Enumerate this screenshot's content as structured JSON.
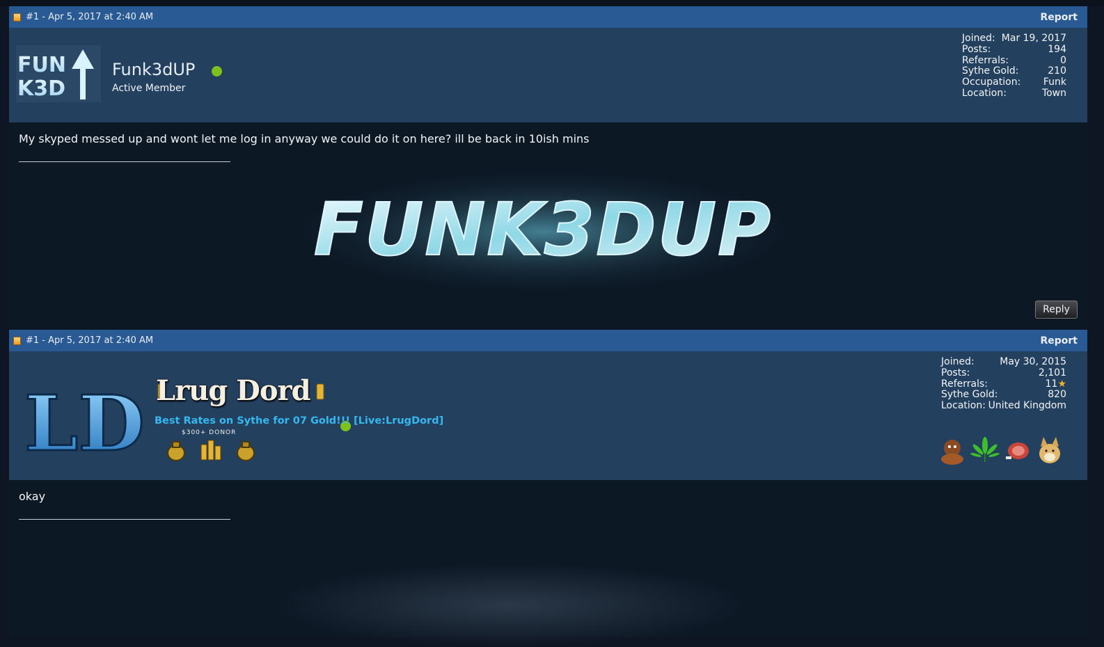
{
  "posts": [
    {
      "header": {
        "meta": "#1 - Apr 5, 2017 at 2:40 AM",
        "report_label": "Report"
      },
      "user": {
        "avatar_text_top": "FUN",
        "avatar_text_bottom": "K3D",
        "name": "Funk3dUP",
        "title": "Active Member",
        "online": true,
        "stats": [
          {
            "label": "Joined:",
            "value": "Mar 19, 2017"
          },
          {
            "label": "Posts:",
            "value": "194"
          },
          {
            "label": "Referrals:",
            "value": "0"
          },
          {
            "label": "Sythe Gold:",
            "value": "210"
          },
          {
            "label": "Occupation:",
            "value": "Funk"
          },
          {
            "label": "Location:",
            "value": "Town"
          }
        ]
      },
      "message": "My skyped messed up and wont let me log in anyway we could do it on here? ill be back in 10ish mins",
      "signature_banner_text": "FUNK3DUP",
      "reply_label": "Reply"
    },
    {
      "header": {
        "meta": "#1 - Apr 5, 2017 at 2:40 AM",
        "report_label": "Report"
      },
      "user": {
        "avatar_text": "LD",
        "name": "Lrug Dord",
        "title": "Best Rates on Sythe for 07 Gold!!! [Live:LrugDord]",
        "donor_label": "$300+ DONOR",
        "online": true,
        "stats": [
          {
            "label": "Joined:",
            "value": "May 30, 2015"
          },
          {
            "label": "Posts:",
            "value": "2,101"
          },
          {
            "label": "Referrals:",
            "value": "11"
          },
          {
            "label": "Sythe Gold:",
            "value": "820"
          },
          {
            "label": "Location:",
            "value": "United Kingdom"
          }
        ]
      },
      "message": "okay"
    }
  ],
  "colors": {
    "header_bar": "#2a5a94",
    "userbar": "#24405f",
    "body": "#0d1825",
    "online": "#7cc21b",
    "user_title_link": "#35b8f0"
  },
  "icons": {
    "post_icon": "post-icon",
    "online": "online-status-icon",
    "referral_star": "star-icon",
    "awards": [
      "gold-sack-icon",
      "gold-bars-icon",
      "gold-sack-icon"
    ],
    "badges": [
      "gorilla-icon",
      "leaf-icon",
      "meat-icon",
      "doge-icon"
    ]
  }
}
